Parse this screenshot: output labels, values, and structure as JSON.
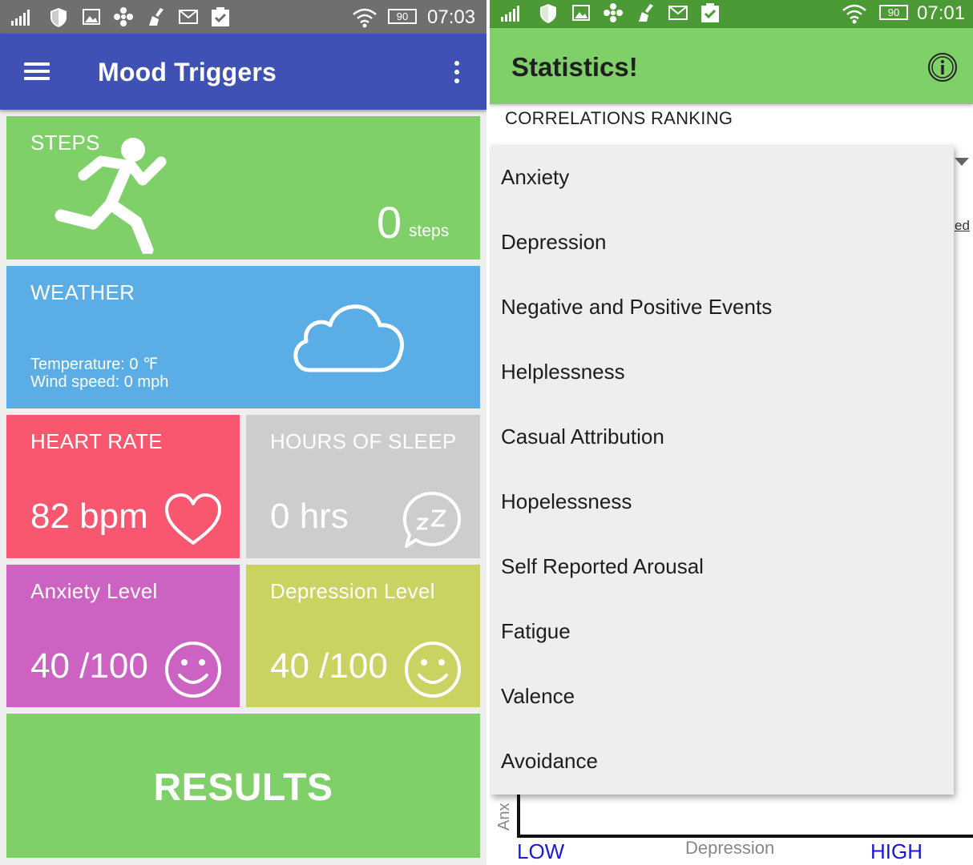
{
  "left": {
    "status_bar": {
      "time": "07:03",
      "battery": "90",
      "icons": [
        "signal-icon",
        "shield-icon",
        "image-icon",
        "flower-icon",
        "broom-icon",
        "mail-icon",
        "clipboard-check-icon",
        "wifi-icon",
        "battery-icon"
      ]
    },
    "app_bar": {
      "title": "Mood Triggers",
      "color": "#3f51b5",
      "icons": [
        "hamburger-menu-icon",
        "overflow-menu-icon"
      ]
    },
    "tiles": {
      "steps": {
        "label": "STEPS",
        "value": "0",
        "unit": "steps",
        "color": "#80d06a",
        "icon": "running-person-icon"
      },
      "weather": {
        "label": "WEATHER",
        "temperature": "Temperature: 0 ℉",
        "wind": "Wind speed: 0 mph",
        "color": "#5aade5",
        "icon": "cloud-icon"
      },
      "heart_rate": {
        "label": "HEART RATE",
        "value": "82 bpm",
        "color": "#f9576f",
        "icon": "heart-icon"
      },
      "sleep": {
        "label": "HOURS OF SLEEP",
        "value": "0 hrs",
        "color": "#cdcdcd",
        "icon": "sleep-bubble-icon"
      },
      "anxiety": {
        "label": "Anxiety Level",
        "value": "40 /100",
        "color": "#cc62c1",
        "icon": "smiley-icon"
      },
      "depression": {
        "label": "Depression Level",
        "value": "40 /100",
        "color": "#cad362",
        "icon": "smiley-icon"
      },
      "results": {
        "label": "RESULTS",
        "color": "#80d06a"
      }
    }
  },
  "right": {
    "status_bar": {
      "time": "07:01",
      "battery": "90",
      "icons": [
        "signal-icon",
        "shield-icon",
        "image-icon",
        "flower-icon",
        "broom-icon",
        "mail-icon",
        "clipboard-check-icon",
        "wifi-icon",
        "battery-icon"
      ]
    },
    "app_bar": {
      "title": "Statistics!",
      "color": "#80d06a",
      "icons": [
        "info-icon"
      ]
    },
    "section_label": "CORRELATIONS RANKING",
    "clipped_text": "ed",
    "dropdown_items": [
      "Anxiety",
      "Depression",
      "Negative and Positive Events",
      "Helplessness",
      "Casual Attribution",
      "Hopelessness",
      "Self Reported Arousal",
      "Fatigue",
      "Valence",
      "Avoidance"
    ],
    "chart": {
      "ylabel": "Anx",
      "xlabel": "Depression",
      "x_low": "LOW",
      "x_high": "HIGH"
    }
  }
}
